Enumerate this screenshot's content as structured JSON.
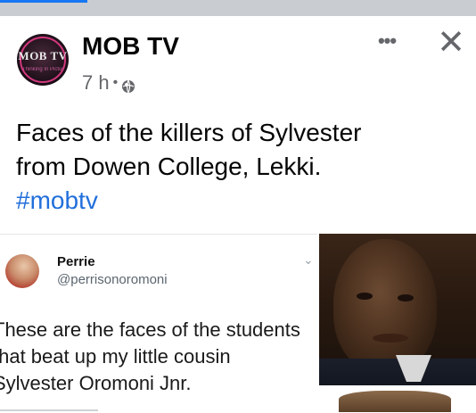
{
  "post": {
    "author": "MOB TV",
    "avatar_text": "MOB TV",
    "avatar_tagline": "Thinking In Pictures",
    "time": "7 h",
    "audience_icon": "globe-icon",
    "more_icon": "more-horizontal-icon",
    "more_label": "•••",
    "close_icon": "close-icon",
    "close_label": "✕",
    "text_line1": "Faces of the killers of Sylvester",
    "text_line2": "from Dowen College, Lekki.",
    "hashtag": "#mobtv"
  },
  "tweet": {
    "name": "Perrie",
    "handle": "@perrisonoromoni",
    "caret": "⌄",
    "line1": "These are the faces of the students",
    "line2": "that beat up my little cousin",
    "line3": "Sylvester Oromoni Jnr."
  },
  "colors": {
    "accent": "#1877f2",
    "hashtag": "#216fdb",
    "secondary_text": "#65676b",
    "topbar": "#c9ccd1"
  }
}
